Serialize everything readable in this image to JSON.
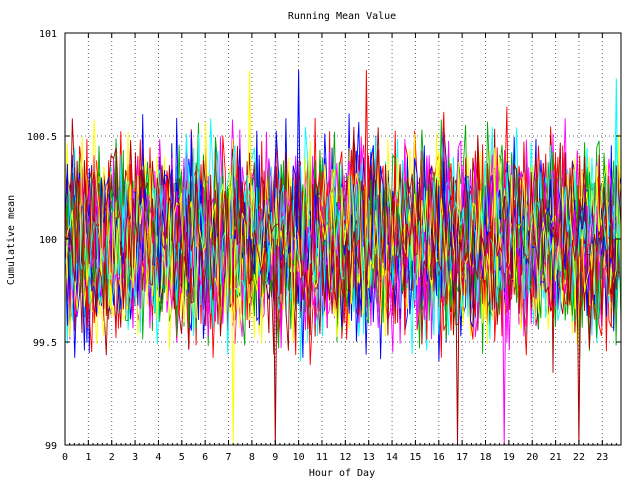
{
  "chart_data": {
    "type": "line",
    "title": "Running Mean Value",
    "xlabel": "Hour of Day",
    "ylabel": "Cumulative mean",
    "xlim": [
      0,
      23.8
    ],
    "ylim": [
      99,
      101
    ],
    "x_ticks": [
      0,
      1,
      2,
      3,
      4,
      5,
      6,
      7,
      8,
      9,
      10,
      11,
      12,
      13,
      14,
      15,
      16,
      17,
      18,
      19,
      20,
      21,
      22,
      23
    ],
    "x_tick_labels": [
      "0",
      "1",
      "2",
      "3",
      "4",
      "5",
      "6",
      "7",
      "8",
      "9",
      "10",
      "11",
      "12",
      "13",
      "14",
      "15",
      "16",
      "17",
      "18",
      "19",
      "20",
      "21",
      "22",
      "23"
    ],
    "y_ticks": [
      99,
      99.5,
      100,
      100.5,
      101
    ],
    "y_tick_labels": [
      "99",
      "99.5",
      "100",
      "100.5",
      "101"
    ],
    "grid": true,
    "grid_style": "dotted",
    "legend": "none",
    "series_colors": [
      "#ff0000",
      "#00aa00",
      "#0000ff",
      "#ff00ff",
      "#00ffff",
      "#ffff00",
      "#aa0000"
    ],
    "series_count": 35,
    "samples_per_series": 230,
    "center_value": 100.0,
    "typical_range": [
      99.55,
      100.45
    ],
    "extreme_values": [
      {
        "x": 7.2,
        "y": 99.0,
        "color": "#ffff00"
      },
      {
        "x": 9.0,
        "y": 99.0,
        "color": "#aa0000"
      },
      {
        "x": 16.8,
        "y": 99.0,
        "color": "#aa0000"
      },
      {
        "x": 18.8,
        "y": 99.0,
        "color": "#ff00ff"
      },
      {
        "x": 22.0,
        "y": 99.0,
        "color": "#aa0000"
      },
      {
        "x": 10.0,
        "y": 100.82,
        "color": "#0000ff"
      },
      {
        "x": 12.9,
        "y": 100.82,
        "color": "#ff0000"
      },
      {
        "x": 7.9,
        "y": 100.82,
        "color": "#ffff00"
      },
      {
        "x": 23.6,
        "y": 100.78,
        "color": "#00ffff"
      }
    ]
  }
}
